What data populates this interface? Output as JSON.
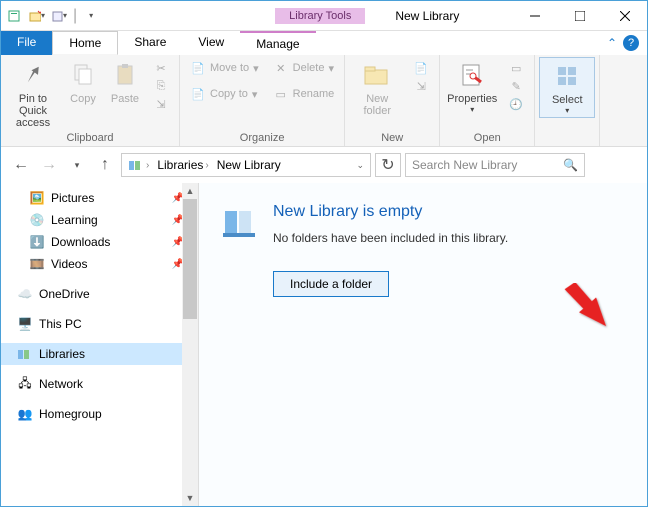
{
  "titlebar": {
    "tool_tab": "Library Tools",
    "window_title": "New Library"
  },
  "tabs": {
    "file": "File",
    "home": "Home",
    "share": "Share",
    "view": "View",
    "manage": "Manage"
  },
  "ribbon": {
    "pin": "Pin to Quick access",
    "copy": "Copy",
    "paste": "Paste",
    "clipboard": "Clipboard",
    "moveto": "Move to",
    "copyto": "Copy to",
    "delete": "Delete",
    "rename": "Rename",
    "organize": "Organize",
    "newfolder": "New folder",
    "new": "New",
    "properties": "Properties",
    "open": "Open",
    "select": "Select"
  },
  "address": {
    "root": "Libraries",
    "current": "New Library"
  },
  "search": {
    "placeholder": "Search New Library"
  },
  "sidebar": {
    "items": [
      {
        "label": "Pictures",
        "pinned": true
      },
      {
        "label": "Learning",
        "pinned": true
      },
      {
        "label": "Downloads",
        "pinned": true
      },
      {
        "label": "Videos",
        "pinned": true
      }
    ],
    "onedrive": "OneDrive",
    "thispc": "This PC",
    "libraries": "Libraries",
    "network": "Network",
    "homegroup": "Homegroup"
  },
  "content": {
    "title": "New Library is empty",
    "sub": "No folders have been included in this library.",
    "button": "Include a folder"
  }
}
